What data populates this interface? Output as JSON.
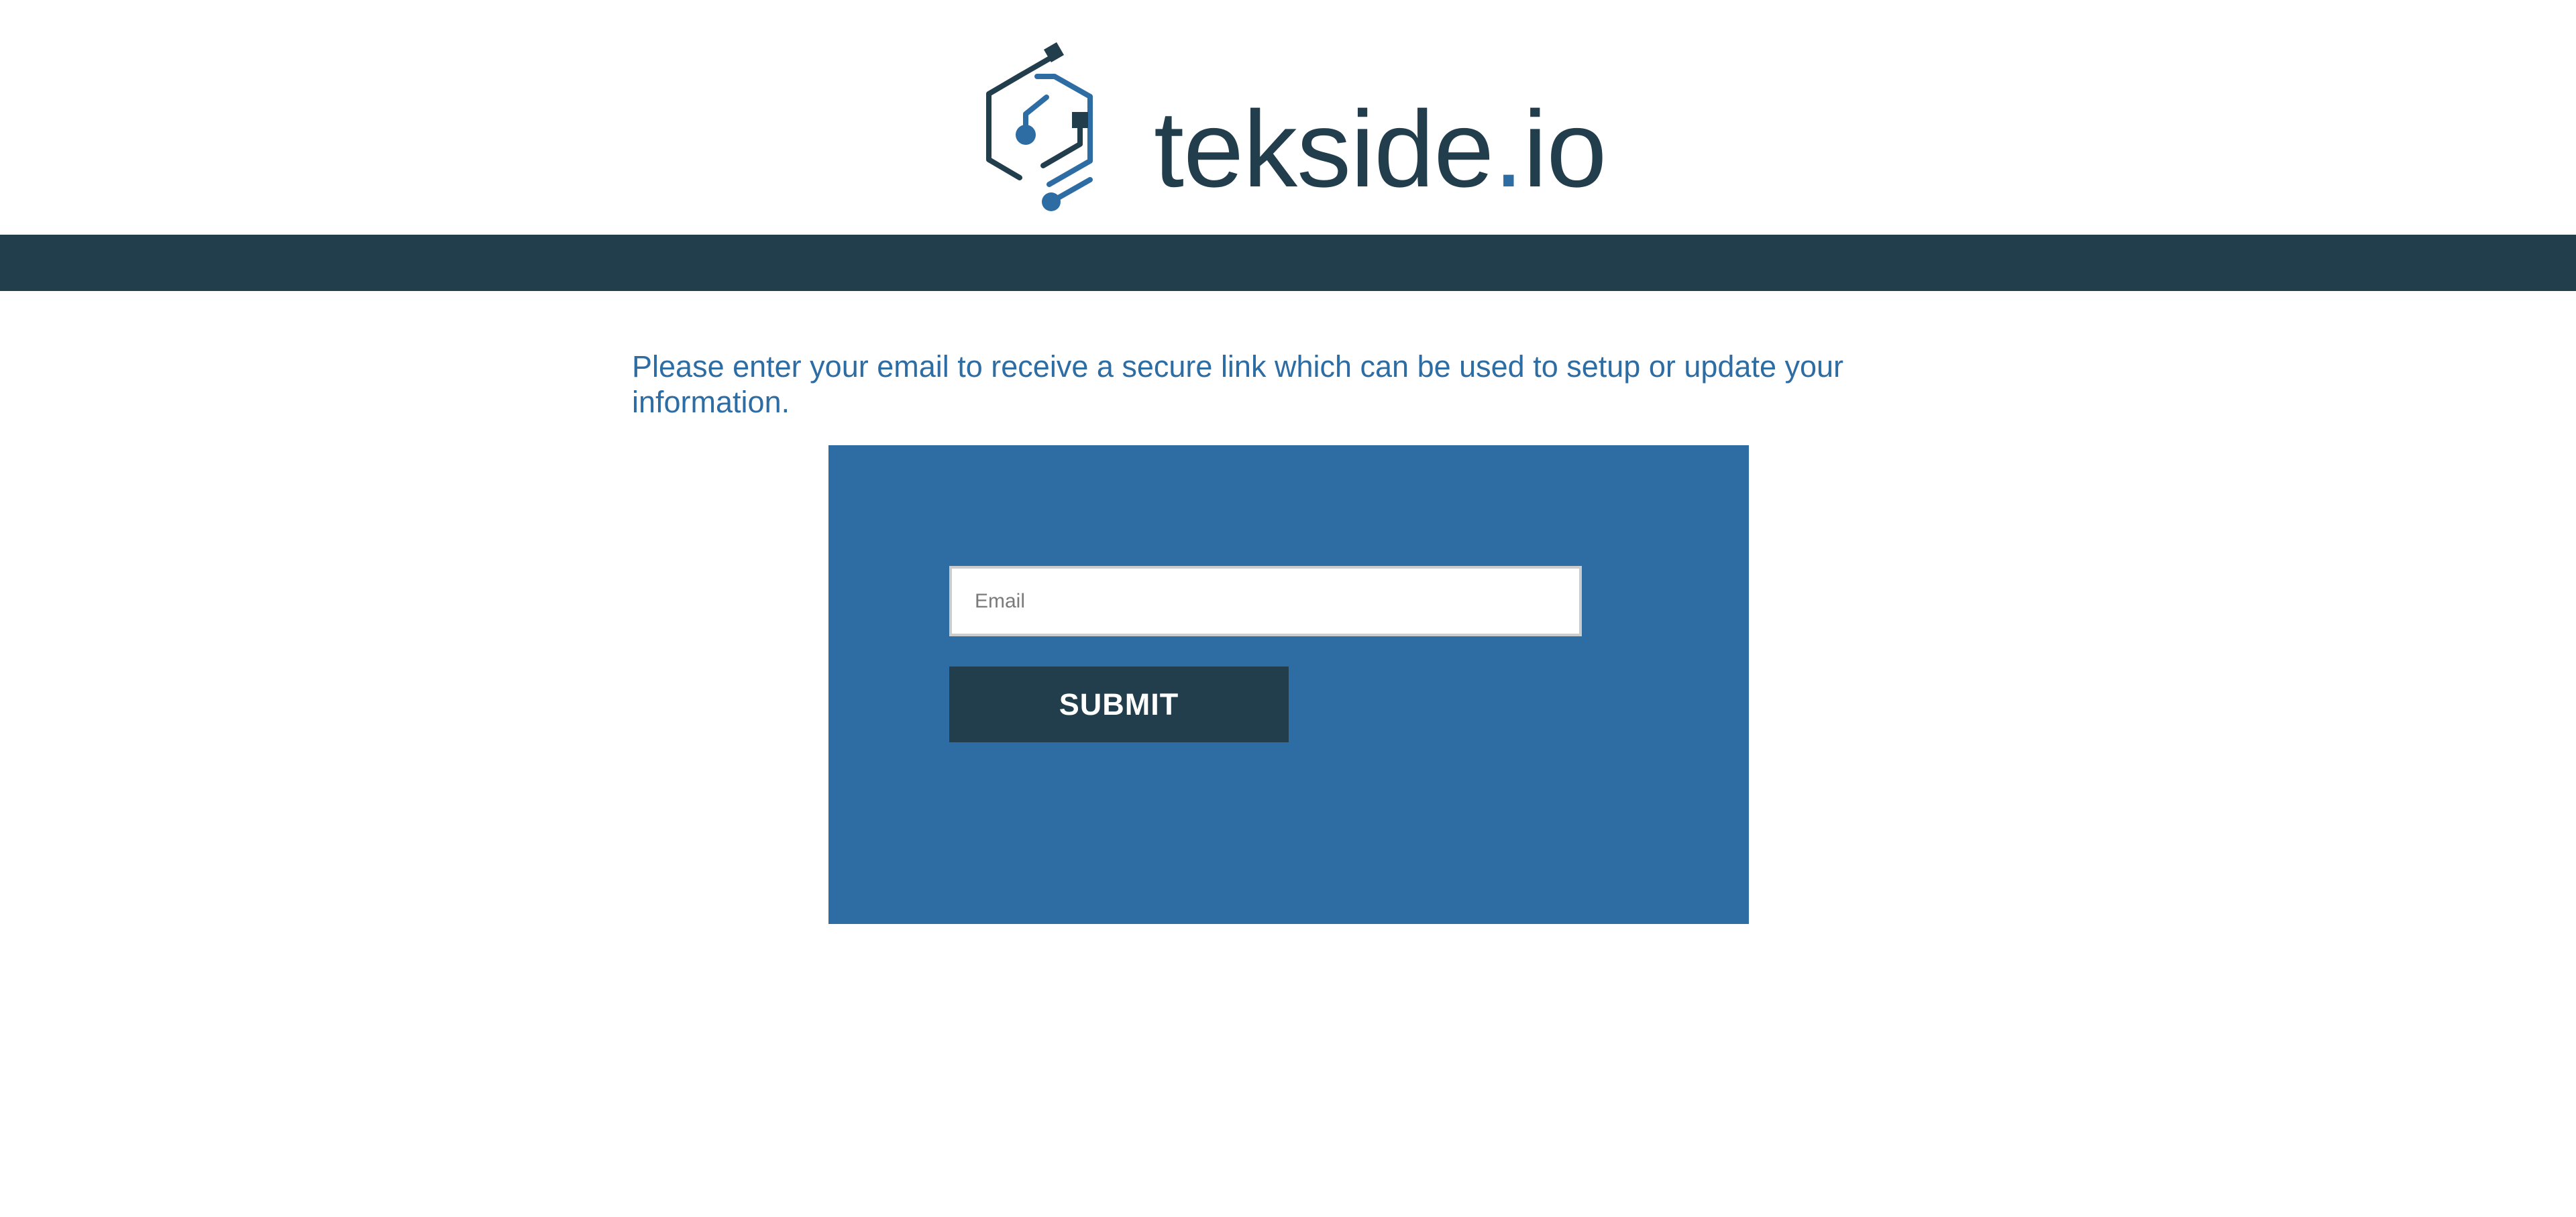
{
  "header": {
    "logo": {
      "name_main": "tekside",
      "name_dot": ".",
      "name_tld": "io",
      "icon": "tekside-circuit-logo-icon"
    }
  },
  "main": {
    "instruction": "Please enter your email to receive a secure link which can be used to setup or update your information.",
    "form": {
      "email_placeholder": "Email",
      "email_value": "",
      "submit_label": "SUBMIT"
    }
  },
  "colors": {
    "brand_dark": "#223d4c",
    "brand_blue": "#2d6da4",
    "background": "#ffffff",
    "input_border": "#cccccc"
  }
}
